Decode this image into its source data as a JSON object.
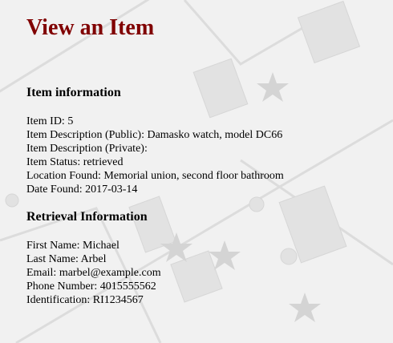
{
  "title": "View an Item",
  "item_section": {
    "heading": "Item information",
    "lines": [
      "Item ID: 5",
      "Item Description (Public): Damasko watch, model DC66",
      "Item Description (Private):",
      "Item Status: retrieved",
      "Location Found: Memorial union, second floor bathroom",
      "Date Found: 2017-03-14"
    ]
  },
  "retrieval_section": {
    "heading": "Retrieval Information",
    "lines": [
      "First Name: Michael",
      "Last Name: Arbel",
      "Email: marbel@example.com",
      "Phone Number: 4015555562",
      "Identification: RI1234567"
    ]
  }
}
